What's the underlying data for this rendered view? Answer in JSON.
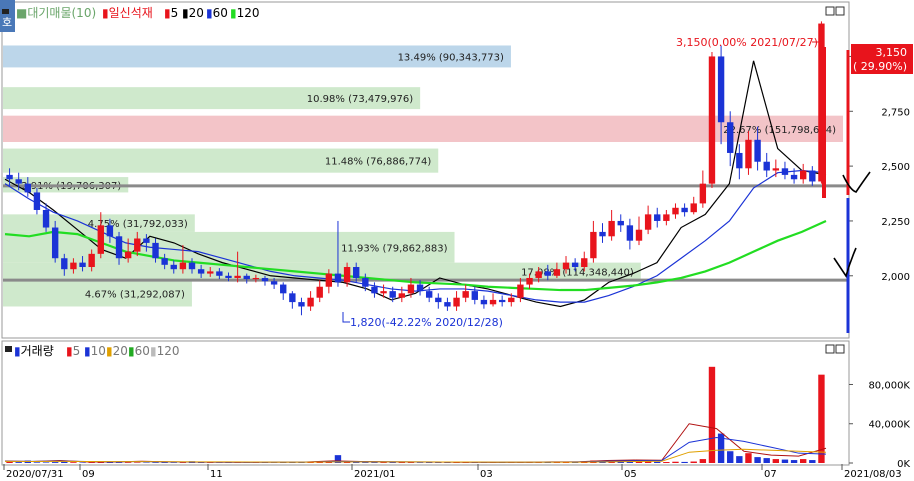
{
  "toolbar": {
    "side_tab": "호",
    "price_legend": {
      "volume_profile": "대기매물(10)",
      "candle": "일신석재",
      "ma5": "5",
      "ma20": "20",
      "ma60": "60",
      "ma120": "120"
    },
    "volume_legend": {
      "title": "거래량",
      "ma5": "5",
      "ma10": "10",
      "ma20": "20",
      "ma60": "60",
      "ma120": "120"
    }
  },
  "colors": {
    "up": "#e8141c",
    "down": "#1b33d6",
    "ma5": "#000000",
    "ma20": "#1b33d6",
    "ma60": "#22dd22",
    "ma120": "#bbbbbb",
    "vp_blue": "#bcd6ea",
    "vp_green": "#cfe9cc",
    "vp_red": "#f3c4c8",
    "current_price_box": "#e8141c"
  },
  "chart_data": [
    {
      "type": "candlestick",
      "title": "일신석재",
      "y_axis_ticks": [
        "3,000",
        "2,750",
        "2,500",
        "2,250",
        "2,000"
      ],
      "y_tick_values": [
        3000,
        2750,
        2500,
        2250,
        2000
      ],
      "ylim": [
        1730,
        3230
      ],
      "x_axis_labels": [
        "2020/07/31",
        "09",
        "11",
        "2021/01",
        "03",
        "05",
        "07",
        "2021/08/03"
      ],
      "current_price": {
        "label": "3,150",
        "change": "( 29.90%)",
        "value": 3150
      },
      "annotations": {
        "high": {
          "text": "3,150(0.00% 2021/07/27)",
          "value": 3150
        },
        "low": {
          "text": "1,820(-42.22% 2020/12/28)",
          "value": 1820
        }
      },
      "horizontal_lines": [
        2410,
        1980
      ],
      "volume_profile": [
        {
          "text": "13.49% (90,343,773)",
          "percent": 13.49,
          "price_from": 2950,
          "price_to": 3050,
          "color": "blue"
        },
        {
          "text": "10.98% (73,479,976)",
          "percent": 10.98,
          "price_from": 2760,
          "price_to": 2860,
          "color": "green"
        },
        {
          "text": "22.67% (151,798,694)",
          "percent": 22.67,
          "price_from": 2610,
          "price_to": 2730,
          "color": "red"
        },
        {
          "text": "11.48% (76,886,774)",
          "percent": 11.48,
          "price_from": 2470,
          "price_to": 2580,
          "color": "green"
        },
        {
          "text": "2.91% (19,706,307)",
          "percent": 2.91,
          "price_from": 2380,
          "price_to": 2450,
          "color": "green"
        },
        {
          "text": "4.75% (31,792,033)",
          "percent": 4.75,
          "price_from": 2200,
          "price_to": 2280,
          "color": "green"
        },
        {
          "text": "11.93% (79,862,883)",
          "percent": 11.93,
          "price_from": 2060,
          "price_to": 2200,
          "color": "green"
        },
        {
          "text": "17.08% (114,348,440)",
          "percent": 17.08,
          "price_from": 1980,
          "price_to": 2060,
          "color": "green"
        },
        {
          "text": "4.67% (31,292,087)",
          "percent": 4.67,
          "price_from": 1860,
          "price_to": 1980,
          "color": "green"
        }
      ],
      "series": [
        {
          "name": "5",
          "values": [
            2440,
            2380,
            2300,
            2210,
            2120,
            2080,
            2180,
            2150,
            2100,
            2060,
            2030,
            2000,
            1990,
            1980,
            1970,
            1940,
            1890,
            1920,
            1990,
            1960,
            1940,
            1910,
            1880,
            1860,
            1890,
            1970,
            2010,
            2060,
            2220,
            2280,
            2420,
            2980,
            2580,
            2480,
            2460
          ]
        },
        {
          "name": "20",
          "values": [
            2420,
            2350,
            2290,
            2250,
            2200,
            2150,
            2130,
            2120,
            2110,
            2080,
            2050,
            2020,
            2000,
            1990,
            1980,
            1960,
            1940,
            1930,
            1940,
            1940,
            1930,
            1910,
            1890,
            1880,
            1880,
            1910,
            1950,
            2000,
            2080,
            2160,
            2250,
            2400,
            2470,
            2480,
            2470
          ]
        },
        {
          "name": "60",
          "values": [
            2190,
            2180,
            2200,
            2190,
            2150,
            2110,
            2090,
            2070,
            2060,
            2050,
            2040,
            2030,
            2020,
            2010,
            2000,
            1990,
            1980,
            1970,
            1965,
            1960,
            1950,
            1945,
            1940,
            1935,
            1935,
            1945,
            1955,
            1970,
            1990,
            2020,
            2060,
            2110,
            2160,
            2200,
            2250
          ]
        }
      ],
      "candles": [
        [
          2460,
          2440,
          2490,
          2410
        ],
        [
          2440,
          2420,
          2470,
          2390
        ],
        [
          2420,
          2380,
          2450,
          2360
        ],
        [
          2380,
          2300,
          2400,
          2280
        ],
        [
          2300,
          2220,
          2330,
          2200
        ],
        [
          2220,
          2080,
          2250,
          2060
        ],
        [
          2080,
          2030,
          2100,
          2000
        ],
        [
          2030,
          2060,
          2080,
          2010
        ],
        [
          2060,
          2040,
          2090,
          2020
        ],
        [
          2040,
          2100,
          2120,
          2020
        ],
        [
          2100,
          2230,
          2290,
          2080
        ],
        [
          2230,
          2180,
          2260,
          2150
        ],
        [
          2180,
          2080,
          2200,
          2050
        ],
        [
          2080,
          2110,
          2170,
          2060
        ],
        [
          2110,
          2170,
          2200,
          2090
        ],
        [
          2170,
          2150,
          2190,
          2110
        ],
        [
          2150,
          2080,
          2170,
          2060
        ],
        [
          2080,
          2050,
          2100,
          2030
        ],
        [
          2050,
          2030,
          2070,
          2010
        ],
        [
          2030,
          2060,
          2140,
          2010
        ],
        [
          2060,
          2030,
          2080,
          2010
        ],
        [
          2030,
          2010,
          2050,
          1990
        ],
        [
          2010,
          2020,
          2040,
          1995
        ],
        [
          2020,
          2000,
          2035,
          1985
        ],
        [
          2000,
          1990,
          2015,
          1975
        ],
        [
          1990,
          2000,
          2110,
          1970
        ],
        [
          2000,
          1985,
          2010,
          1965
        ],
        [
          1985,
          1990,
          2005,
          1970
        ],
        [
          1990,
          1975,
          2000,
          1955
        ],
        [
          1975,
          1960,
          1990,
          1940
        ],
        [
          1960,
          1920,
          1970,
          1890
        ],
        [
          1920,
          1880,
          1930,
          1850
        ],
        [
          1880,
          1860,
          1900,
          1820
        ],
        [
          1860,
          1900,
          1930,
          1840
        ],
        [
          1900,
          1950,
          1980,
          1880
        ],
        [
          1950,
          2010,
          2030,
          1920
        ],
        [
          2010,
          1970,
          2250,
          1950
        ],
        [
          1970,
          2040,
          2060,
          1950
        ],
        [
          2040,
          1990,
          2060,
          1970
        ],
        [
          1990,
          1950,
          2010,
          1930
        ],
        [
          1950,
          1920,
          1970,
          1900
        ],
        [
          1920,
          1930,
          1960,
          1900
        ],
        [
          1930,
          1900,
          1950,
          1880
        ],
        [
          1900,
          1920,
          1950,
          1880
        ],
        [
          1920,
          1960,
          1990,
          1900
        ],
        [
          1960,
          1930,
          1980,
          1910
        ],
        [
          1930,
          1900,
          1950,
          1880
        ],
        [
          1900,
          1880,
          1920,
          1850
        ],
        [
          1880,
          1860,
          1900,
          1840
        ],
        [
          1860,
          1900,
          1930,
          1840
        ],
        [
          1900,
          1930,
          1960,
          1880
        ],
        [
          1930,
          1890,
          1950,
          1870
        ],
        [
          1890,
          1870,
          1910,
          1850
        ],
        [
          1870,
          1890,
          1920,
          1860
        ],
        [
          1890,
          1880,
          1910,
          1860
        ],
        [
          1880,
          1900,
          1920,
          1860
        ],
        [
          1900,
          1960,
          1990,
          1880
        ],
        [
          1960,
          1990,
          2010,
          1940
        ],
        [
          1990,
          2020,
          2040,
          1970
        ],
        [
          2020,
          2000,
          2050,
          1980
        ],
        [
          2000,
          2030,
          2060,
          1990
        ],
        [
          2030,
          2060,
          2090,
          2010
        ],
        [
          2060,
          2040,
          2080,
          2020
        ],
        [
          2040,
          2080,
          2110,
          2020
        ],
        [
          2080,
          2200,
          2250,
          2060
        ],
        [
          2200,
          2180,
          2240,
          2150
        ],
        [
          2180,
          2250,
          2300,
          2160
        ],
        [
          2250,
          2230,
          2280,
          2200
        ],
        [
          2230,
          2160,
          2260,
          2120
        ],
        [
          2160,
          2210,
          2270,
          2140
        ],
        [
          2210,
          2280,
          2320,
          2190
        ],
        [
          2280,
          2250,
          2310,
          2220
        ],
        [
          2250,
          2280,
          2300,
          2230
        ],
        [
          2280,
          2310,
          2330,
          2260
        ],
        [
          2310,
          2290,
          2330,
          2270
        ],
        [
          2290,
          2330,
          2360,
          2280
        ],
        [
          2330,
          2420,
          2480,
          2310
        ],
        [
          2420,
          3000,
          3020,
          2400
        ],
        [
          3000,
          2700,
          3050,
          2600
        ],
        [
          2700,
          2560,
          2750,
          2500
        ],
        [
          2560,
          2490,
          2600,
          2440
        ],
        [
          2490,
          2620,
          2660,
          2460
        ],
        [
          2620,
          2520,
          2680,
          2480
        ],
        [
          2520,
          2480,
          2560,
          2450
        ],
        [
          2480,
          2490,
          2530,
          2450
        ],
        [
          2490,
          2460,
          2520,
          2440
        ],
        [
          2460,
          2440,
          2490,
          2420
        ],
        [
          2440,
          2480,
          2510,
          2420
        ],
        [
          2480,
          2430,
          2500,
          2410
        ],
        [
          2430,
          3150,
          3160,
          2420
        ]
      ]
    },
    {
      "type": "bar",
      "title": "거래량",
      "y_axis_ticks": [
        "80,000K",
        "40,000K",
        "0K"
      ],
      "y_tick_values": [
        80000,
        40000,
        0
      ],
      "ylim": [
        0,
        108000
      ],
      "unit": "K",
      "series": [
        {
          "name": "5",
          "values": [
            2000,
            1500,
            2500,
            1200,
            1000,
            1800,
            1100,
            900,
            800,
            700,
            900,
            1000,
            2200,
            1500,
            1200,
            1000,
            900,
            800,
            700,
            800,
            1100,
            1300,
            2500,
            3000,
            2800,
            40000,
            35000,
            12000,
            8000,
            7000,
            15000
          ]
        },
        {
          "name": "10",
          "values": [
            1800,
            1600,
            1900,
            1500,
            1300,
            1400,
            1200,
            1000,
            900,
            800,
            850,
            900,
            1500,
            1400,
            1300,
            1100,
            1000,
            900,
            800,
            800,
            950,
            1100,
            1800,
            2300,
            2500,
            21000,
            26000,
            22000,
            16000,
            10000,
            9000
          ]
        },
        {
          "name": "20",
          "values": [
            1600,
            1500,
            1600,
            1500,
            1400,
            1400,
            1300,
            1200,
            1100,
            1000,
            950,
            950,
            1100,
            1200,
            1200,
            1100,
            1050,
            1000,
            950,
            900,
            900,
            950,
            1200,
            1500,
            1800,
            11000,
            13000,
            14000,
            13000,
            12000,
            11000
          ]
        }
      ],
      "bars": [
        1200,
        900,
        2500,
        700,
        600,
        900,
        2200,
        800,
        500,
        700,
        1500,
        900,
        600,
        700,
        500,
        400,
        600,
        800,
        400,
        500,
        1800,
        600,
        500,
        400,
        700,
        500,
        400,
        600,
        500,
        400,
        500,
        700,
        600,
        800,
        900,
        1200,
        8000,
        1500,
        900,
        700,
        600,
        500,
        700,
        600,
        500,
        400,
        600,
        500,
        700,
        500,
        600,
        500,
        400,
        600,
        500,
        700,
        900,
        1200,
        800,
        700,
        900,
        1000,
        800,
        1200,
        2500,
        1500,
        2000,
        1300,
        1000,
        1400,
        1800,
        1200,
        1000,
        1300,
        1100,
        1500,
        4000,
        98000,
        30000,
        12000,
        7000,
        10000,
        6000,
        5000,
        4000,
        3500,
        3000,
        4000,
        3000,
        90000
      ]
    }
  ]
}
